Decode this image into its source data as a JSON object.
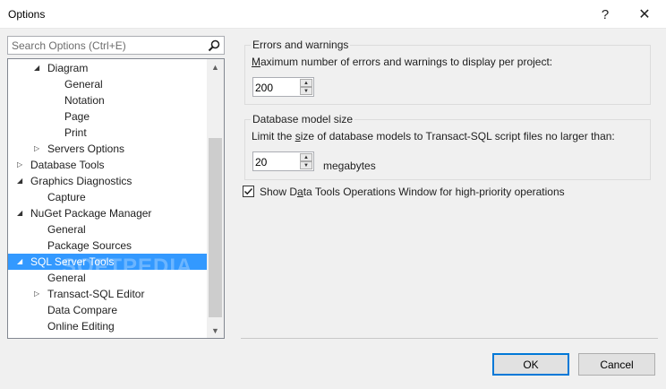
{
  "window": {
    "title": "Options",
    "help_glyph": "?",
    "close_glyph": "✕"
  },
  "search": {
    "placeholder": "Search Options (Ctrl+E)"
  },
  "tree": {
    "items": [
      {
        "label": "Diagram",
        "arrow": "◢"
      },
      {
        "label": "General"
      },
      {
        "label": "Notation"
      },
      {
        "label": "Page"
      },
      {
        "label": "Print"
      },
      {
        "label": "Servers Options",
        "arrow": "▷"
      },
      {
        "label": "Database Tools",
        "arrow": "▷"
      },
      {
        "label": "Graphics Diagnostics",
        "arrow": "◢"
      },
      {
        "label": "Capture"
      },
      {
        "label": "NuGet Package Manager",
        "arrow": "◢"
      },
      {
        "label": "General"
      },
      {
        "label": "Package Sources"
      },
      {
        "label": "SQL Server Tools",
        "arrow": "◢"
      },
      {
        "label": "General"
      },
      {
        "label": "Transact-SQL Editor",
        "arrow": "▷"
      },
      {
        "label": "Data Compare"
      },
      {
        "label": "Online Editing"
      }
    ],
    "watermark": "SOFTPEDIA",
    "scroll_up_glyph": "▲",
    "scroll_down_glyph": "▼"
  },
  "errors_group": {
    "caption": "Errors and warnings",
    "desc_accel": "M",
    "desc_rest": "aximum number of errors and warnings to display per project:",
    "value": "200"
  },
  "db_group": {
    "caption": "Database model size",
    "desc_pre": "Limit the ",
    "desc_accel": "s",
    "desc_post": "ize of database models to Transact-SQL script files no larger than:",
    "value": "20",
    "unit": "megabytes"
  },
  "ops_window": {
    "checked": true,
    "label_pre": "Show D",
    "label_accel": "a",
    "label_post": "ta Tools Operations Window for high-priority operations"
  },
  "buttons": {
    "ok": "OK",
    "cancel": "Cancel"
  },
  "colors": {
    "selection": "#3399ff",
    "default_button_border": "#0078d7"
  }
}
